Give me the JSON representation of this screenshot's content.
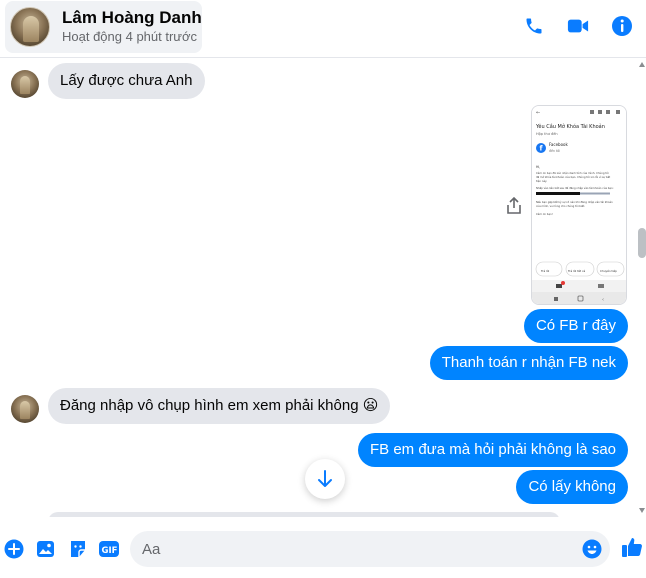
{
  "header": {
    "contact_name": "Lâm Hoàng Danh",
    "contact_status": "Hoạt động 4 phút trước",
    "icons": [
      "phone-icon",
      "video-camera-icon",
      "info-icon"
    ]
  },
  "messages": {
    "m1": "Lấy được chưa Anh",
    "m2": "Có FB r đây",
    "m3": "Thanh toán r nhận FB nek",
    "m4": "Đăng nhập vô chụp hình em xem phải không 😦",
    "m5": "FB em đưa mà hỏi phải không là sao",
    "m6": "Có lấy không"
  },
  "attachment": {
    "title": "Yêu Cầu Mở Khóa Tài Khoản",
    "tag": "Hộp thư đến",
    "sender": "Facebook",
    "recipient": "đến tôi",
    "greeting": "Hi,",
    "body_lines": [
      "Cảm ơn bạn đã xác nhận danh tính của mình. Chúng tôi",
      "đã mở khóa tài khoản của bạn. Chúng tôi xin lỗi vì sự bất",
      "tiện này.",
      "Nhấp vào liên kết sau để đăng nhập vào tài khoản của bạn:",
      "Nếu bạn gặp bất kỳ sự cố nào khi đăng nhập vào tài khoản",
      "của mình, vui lòng cho chúng tôi biết.",
      "Cảm ơn bạn!"
    ],
    "actions": [
      "Trả lời",
      "Trả lời tất cả",
      "Chuyển tiếp"
    ]
  },
  "composer": {
    "placeholder": "Aa",
    "icons": [
      "plus-icon",
      "image-icon",
      "sticker-icon",
      "gif-icon",
      "emoji-icon",
      "thumbs-up-icon"
    ],
    "gif_label": "GIF"
  },
  "colors": {
    "accent": "#0084ff",
    "incoming_bubble": "#e4e6eb",
    "icon_blue": "#0a7cff"
  }
}
